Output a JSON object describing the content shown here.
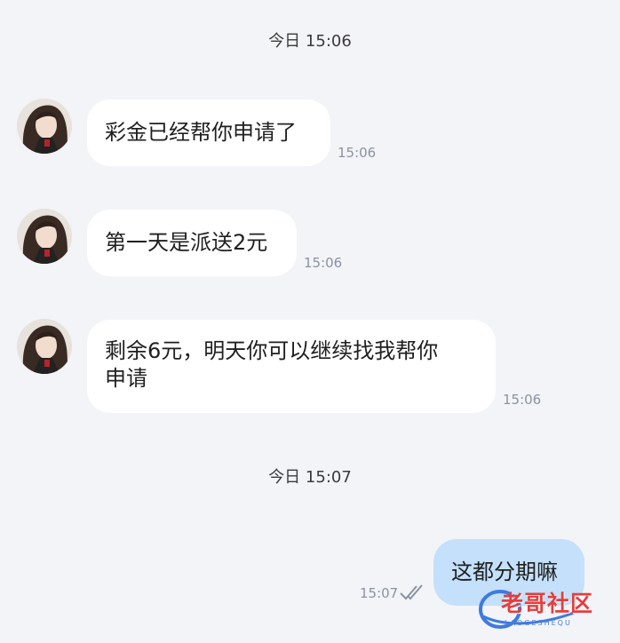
{
  "separators": [
    "今日 15:06",
    "今日 15:07"
  ],
  "messages": [
    {
      "text": "彩金已经帮你申请了",
      "time": "15:06",
      "from": "other"
    },
    {
      "text": "第一天是派送2元",
      "time": "15:06",
      "from": "other"
    },
    {
      "text_line1": "剩余6元，明天你可以继续找我帮你",
      "text_line2": "申请",
      "time": "15:06",
      "from": "other"
    },
    {
      "text": "这都分期嘛",
      "time": "15:07",
      "from": "me",
      "status": "read"
    }
  ],
  "watermark": {
    "title": "老哥社区",
    "subtitle": "LAOGESHEQU"
  },
  "colors": {
    "background": "#f3f4f8",
    "incoming_bubble": "#ffffff",
    "outgoing_bubble": "#c4e0fb",
    "timestamp": "#8a93a0"
  },
  "icons": [
    "avatar",
    "double-check-icon",
    "watermark-logo"
  ]
}
